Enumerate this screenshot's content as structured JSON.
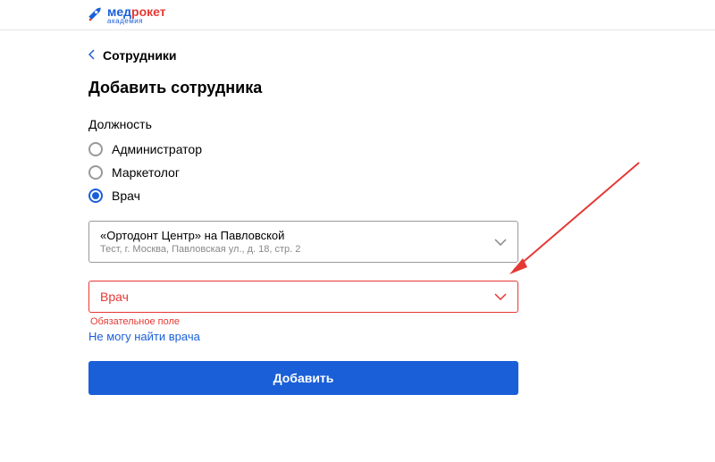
{
  "logo": {
    "med": "мед",
    "roket": "рокет",
    "sub": "академия"
  },
  "breadcrumb": {
    "label": "Сотрудники"
  },
  "page": {
    "title": "Добавить сотрудника"
  },
  "form": {
    "position_label": "Должность",
    "radios": [
      {
        "label": "Администратор",
        "selected": false
      },
      {
        "label": "Маркетолог",
        "selected": false
      },
      {
        "label": "Врач",
        "selected": true
      }
    ],
    "clinic_select": {
      "main": "«Ортодонт Центр» на Павловской",
      "sub": "Тест, г. Москва, Павловская ул., д. 18, стр. 2"
    },
    "doctor_select": {
      "main": "Врач",
      "error": "Обязательное поле"
    },
    "cant_find_link": "Не могу найти врача",
    "submit_label": "Добавить"
  }
}
